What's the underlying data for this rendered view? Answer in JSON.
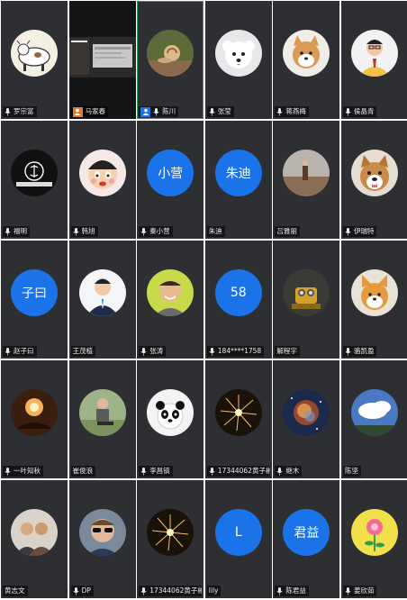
{
  "colors": {
    "tile_bg": "#2e2f33",
    "text_avatar_bg": "#1a73e8",
    "active_border": "#2e9f5a",
    "label_text": "#e8e8e8"
  },
  "participants": [
    {
      "name": "罗宗富",
      "avatar": "cow-icon"
    },
    {
      "name": "马家春",
      "video": true,
      "badge": "orange-user-icon"
    },
    {
      "name": "陈川",
      "avatar": "snail-icon",
      "active": true,
      "badge": "blue-user-icon"
    },
    {
      "name": "张莹",
      "avatar": "white-dog-icon"
    },
    {
      "name": "蒋燕梅",
      "avatar": "shiba-dog-icon"
    },
    {
      "name": "侯晶青",
      "avatar": "person-icon"
    },
    {
      "name": "福明",
      "avatar": "brand-logo-icon"
    },
    {
      "name": "韩旭",
      "avatar": "cartoon-kid-icon"
    },
    {
      "name": "秦小营",
      "text": "小营"
    },
    {
      "name": "朱迪",
      "text": "朱迪",
      "no_mic": true
    },
    {
      "name": "吕雅丽",
      "avatar": "field-scene-icon",
      "no_mic": true
    },
    {
      "name": "伊瑞特",
      "avatar": "dog-face-icon"
    },
    {
      "name": "赵子曰",
      "text": "子曰"
    },
    {
      "name": "王茂植",
      "avatar": "man-suit-icon",
      "no_mic": true
    },
    {
      "name": "张涛",
      "avatar": "man-smile-icon"
    },
    {
      "name": "184****1758",
      "text": "58"
    },
    {
      "name": "解程宇",
      "avatar": "robot-icon",
      "no_mic": true
    },
    {
      "name": "骆凯盈",
      "avatar": "corgi-icon"
    },
    {
      "name": "一叶知秋",
      "avatar": "sunset-icon"
    },
    {
      "name": "崔俊浪",
      "avatar": "sitting-man-icon",
      "no_mic": true
    },
    {
      "name": "李昌镐",
      "avatar": "panda-icon"
    },
    {
      "name": "17344062黄子彬",
      "avatar": "firework-icon"
    },
    {
      "name": "继木",
      "avatar": "nebula-icon"
    },
    {
      "name": "陈坚",
      "avatar": "cloud-sky-icon",
      "no_mic": true
    },
    {
      "name": "黄志文",
      "avatar": "two-people-icon",
      "no_mic": true
    },
    {
      "name": "DP",
      "avatar": "sunglasses-man-icon"
    },
    {
      "name": "17344062黄子彬",
      "avatar": "firework-icon"
    },
    {
      "name": "lily",
      "text": "L",
      "no_mic": true
    },
    {
      "name": "陈君益",
      "text": "君益"
    },
    {
      "name": "姜欣茹",
      "avatar": "flower-icon"
    }
  ]
}
